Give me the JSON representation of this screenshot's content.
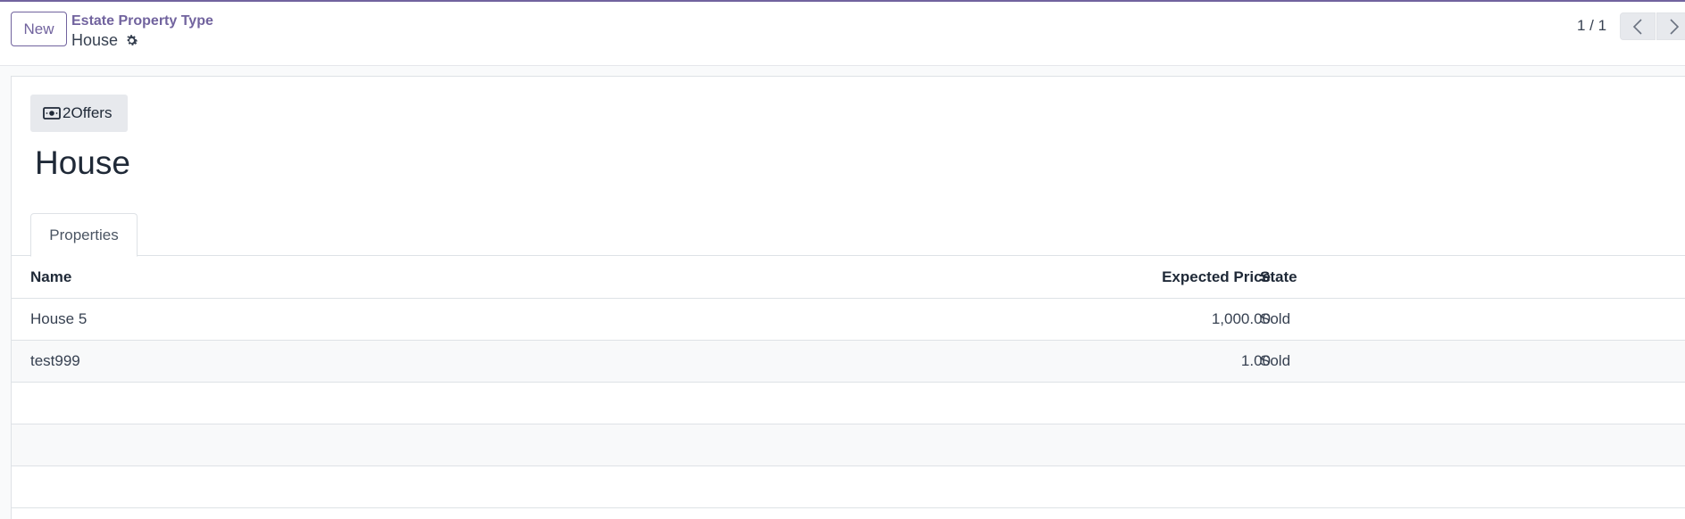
{
  "control_panel": {
    "new_label": "New",
    "breadcrumb_parent": "Estate Property Type",
    "breadcrumb_current": "House",
    "pager_value": "1 / 1"
  },
  "smart_button": {
    "count": "2",
    "label": "Offers",
    "icon": "money-icon"
  },
  "record": {
    "title": "House"
  },
  "tabs": [
    {
      "label": "Properties"
    }
  ],
  "list": {
    "columns": [
      "Name",
      "Expected Price",
      "State"
    ],
    "rows": [
      {
        "name": "House 5",
        "expected_price": "1,000.00",
        "state": "Sold"
      },
      {
        "name": "test999",
        "expected_price": "1.00",
        "state": "Sold"
      }
    ]
  },
  "colors": {
    "brand": "#71639e",
    "button_bg": "#e7e9ed"
  }
}
